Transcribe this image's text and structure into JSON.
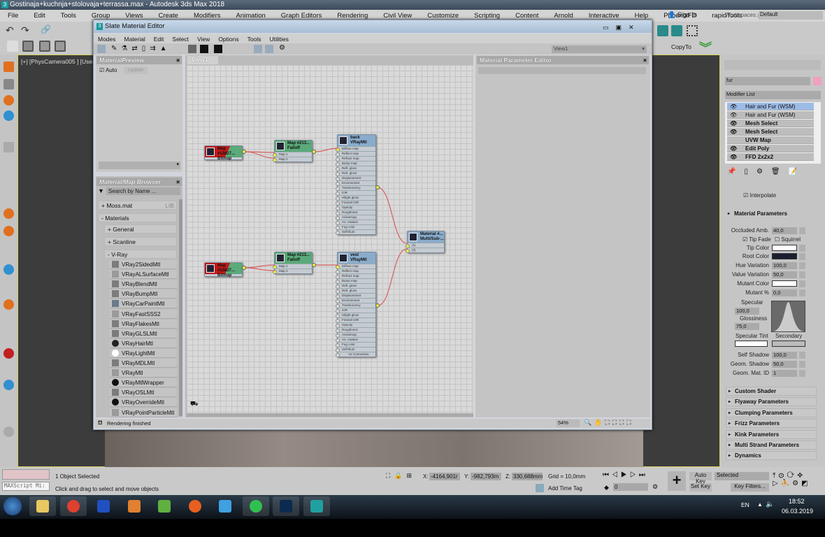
{
  "window": {
    "title": "Gostinaja+kuchnja+stolovaja+terrassa.max - Autodesk 3ds Max 2018",
    "app_icon": "3"
  },
  "menubar": [
    "File",
    "Edit",
    "Tools",
    "Group",
    "Views",
    "Create",
    "Modifiers",
    "Animation",
    "Graph Editors",
    "Rendering",
    "Civil View",
    "Customize",
    "Scripting",
    "Content",
    "Arnold",
    "Interactive",
    "Help",
    "PhoenixFD",
    "rapidTools",
    "»"
  ],
  "account": {
    "sign_in": "Sign In",
    "workspaces_label": "Workspaces:",
    "workspace": "Default"
  },
  "toolbar": {
    "copy_to": "CopyTo"
  },
  "viewport": {
    "label": "[+] [PhysCamera005 ] [User"
  },
  "slate": {
    "title": "Slate Material Editor",
    "menu": [
      "Modes",
      "Material",
      "Edit",
      "Select",
      "View",
      "Options",
      "Tools",
      "Utilities"
    ],
    "view_dropdown": "View1",
    "preview": {
      "title": "MaterialPreview",
      "auto": "Auto",
      "update": "Update"
    },
    "browser": {
      "title": "Material/Map Browser",
      "search_placeholder": "Search by Name ...",
      "groups": [
        {
          "label": "+ Moss.mat",
          "tag": "LIB"
        },
        {
          "label": "- Materials"
        },
        {
          "label": "+ General"
        },
        {
          "label": "+ Scanline"
        },
        {
          "label": "- V-Ray"
        }
      ],
      "items": [
        {
          "name": "VRay2SidedMtl",
          "icon": "#7c7c7c"
        },
        {
          "name": "VRayALSurfaceMtl",
          "icon": "#9a9a9a"
        },
        {
          "name": "VRayBlendMtl",
          "icon": "#7c7c7c"
        },
        {
          "name": "VRayBumpMtl",
          "icon": "#7c7c7c"
        },
        {
          "name": "VRayCarPaintMtl",
          "icon": "#6a7a8a"
        },
        {
          "name": "VRayFastSSS2",
          "icon": "#9a9a9a"
        },
        {
          "name": "VRayFlakesMtl",
          "icon": "#7c7c7c"
        },
        {
          "name": "VRayGLSLMtl",
          "icon": "#7c7c7c"
        },
        {
          "name": "VRayHairMtl",
          "icon": "#222"
        },
        {
          "name": "VRayLightMtl",
          "icon": "#fff"
        },
        {
          "name": "VRayMDLMtl",
          "icon": "#7c7c7c"
        },
        {
          "name": "VRayMtl",
          "icon": "#9a9a9a"
        },
        {
          "name": "VRayMtlWrapper",
          "icon": "#111"
        },
        {
          "name": "VRayOSLMtl",
          "icon": "#7c7c7c"
        },
        {
          "name": "VRayOverrideMtl",
          "icon": "#111"
        },
        {
          "name": "VRayPointParticleMtl",
          "icon": "#9a9a9a"
        }
      ]
    },
    "view_tab": "View1",
    "param_editor": "Material Parameter Editor",
    "status": "Rendering finished",
    "zoom": "54%",
    "nodes": {
      "bitmap1": {
        "name": "Map #13827...",
        "type": "Bitmap"
      },
      "falloff1": {
        "name": "Map #213...",
        "type": "Falloff",
        "slots": [
          "Map 1",
          "Map 2"
        ]
      },
      "vray1": {
        "name": "back",
        "type": "VRayMtl"
      },
      "multi": {
        "name": "Material #...",
        "type": "Multi/Sub-...",
        "slots": [
          "(1)",
          "(2)"
        ]
      },
      "bitmap2": {
        "name": "Map #13827...",
        "type": "Bitmap"
      },
      "falloff2": {
        "name": "Map #213...",
        "type": "Falloff",
        "slots": [
          "Map 1",
          "Map 2"
        ]
      },
      "vray2": {
        "name": "vest",
        "type": "VRayMtl",
        "footer": "mr Connection"
      },
      "vray_slots": [
        "Diffuse map",
        "Reflect map",
        "Refract map",
        "Bump map",
        "Refl. gloss",
        "Refr. gloss",
        "Displacement",
        "Environment",
        "Translucency",
        "IOR",
        "Hilight gloss",
        "Fresnel IOR",
        "Opacity",
        "Roughness",
        "Anisotropy",
        "An. rotation",
        "Fog color",
        "Self-illum"
      ]
    }
  },
  "command_panel": {
    "object_name": "fur",
    "object_color": "#f0a0c0",
    "modifier_list": "Modifier List",
    "stack": [
      "Hair and Fur (WSM)",
      "Hair and Fur (WSM)",
      "Mesh Select",
      "Mesh Select",
      "UVW Map",
      "Edit Poly",
      "FFD 2x2x2"
    ],
    "interpolate": "Interpolate",
    "material_params": {
      "title": "Material Parameters",
      "occluded_amb": {
        "label": "Occluded Amb.",
        "value": "40,0"
      },
      "tip_fade": "Tip Fade",
      "squirrel": "Squirrel",
      "tip_color": {
        "label": "Tip Color",
        "color": "#ffffff"
      },
      "root_color": {
        "label": "Root Color",
        "color": "#1c1e30"
      },
      "hue_variation": {
        "label": "Hue Variation",
        "value": "100,0"
      },
      "value_variation": {
        "label": "Value Variation",
        "value": "50,0"
      },
      "mutant_color": {
        "label": "Mutant Color",
        "color": "#ffffff"
      },
      "mutant_pct": {
        "label": "Mutant %",
        "value": "0,0"
      },
      "specular": {
        "label": "Specular",
        "value": "100,0"
      },
      "glossiness": {
        "label": "Glossiness",
        "value": "75,0"
      },
      "specular_tint": "Specular Tint",
      "secondary": "Secondary",
      "self_shadow": {
        "label": "Self Shadow",
        "value": "100,0"
      },
      "geom_shadow": {
        "label": "Geom. Shadow",
        "value": "50,0"
      },
      "geom_mat_id": {
        "label": "Geom. Mat. ID",
        "value": "1"
      }
    },
    "rollouts": [
      "Custom Shader",
      "Flyaway Parameters",
      "Clumping Parameters",
      "Frizz Parameters",
      "Kink Parameters",
      "Multi Strand Parameters",
      "Dynamics"
    ]
  },
  "statusbar": {
    "maxscript": "MAXScript Mi:",
    "selection": "1 Object Selected",
    "prompt": "Click and drag to select and move objects",
    "x_label": "X:",
    "x": "-4164,901r",
    "y_label": "Y:",
    "y": "-982,793m",
    "z_label": "Z:",
    "z": "330,688mm",
    "grid": "Grid = 10,0mm",
    "add_time_tag": "Add Time Tag",
    "frame": "0",
    "auto_key": "Auto Key",
    "set_key": "Set Key",
    "key_mode": "Selected",
    "key_filters": "Key Filters..."
  },
  "taskbar": {
    "lang": "EN",
    "time": "18:52",
    "date": "06.03.2019",
    "apps": [
      {
        "name": "explorer",
        "color": "#e8c860"
      },
      {
        "name": "chrome",
        "color": "#e04030"
      },
      {
        "name": "app-blue",
        "color": "#2050c0"
      },
      {
        "name": "media",
        "color": "#e08030"
      },
      {
        "name": "coreldraw",
        "color": "#60b040"
      },
      {
        "name": "firefox",
        "color": "#e86020"
      },
      {
        "name": "archicad",
        "color": "#40a0e0"
      },
      {
        "name": "whatsapp",
        "color": "#30c050"
      },
      {
        "name": "photoshop",
        "color": "#0a2a50"
      },
      {
        "name": "3dsmax",
        "color": "#20a0a0"
      }
    ]
  }
}
